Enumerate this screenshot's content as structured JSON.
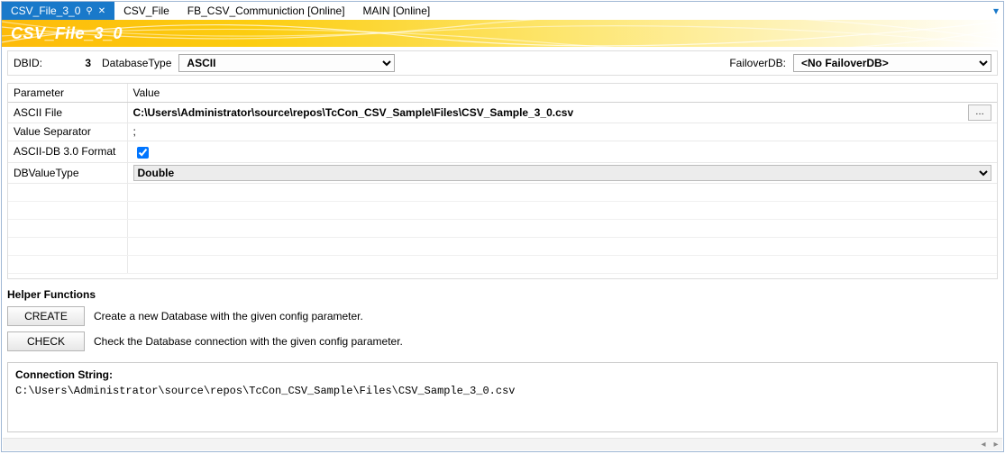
{
  "tabs": {
    "items": [
      {
        "label": "CSV_File_3_0",
        "active": true
      },
      {
        "label": "CSV_File",
        "active": false
      },
      {
        "label": "FB_CSV_Communiction [Online]",
        "active": false
      },
      {
        "label": "MAIN [Online]",
        "active": false
      }
    ]
  },
  "banner": {
    "title": "CSV_File_3_0"
  },
  "dbid": {
    "label": "DBID:",
    "value": "3",
    "dbtype_label": "DatabaseType",
    "dbtype_value": "ASCII",
    "failover_label": "FailoverDB:",
    "failover_value": "<No FailoverDB>"
  },
  "param_grid": {
    "headers": {
      "param": "Parameter",
      "value": "Value"
    },
    "rows": [
      {
        "param": "ASCII File",
        "value": "C:\\Users\\Administrator\\source\\repos\\TcCon_CSV_Sample\\Files\\CSV_Sample_3_0.csv",
        "type": "text-browse",
        "bold": true
      },
      {
        "param": "Value Separator",
        "value": ";",
        "type": "text",
        "bold": false
      },
      {
        "param": "ASCII-DB 3.0 Format",
        "value": true,
        "type": "checkbox"
      },
      {
        "param": "DBValueType",
        "value": "Double",
        "type": "select",
        "bold": true
      }
    ]
  },
  "helper": {
    "title": "Helper Functions",
    "create_label": "CREATE",
    "create_desc": "Create a new Database with the given config parameter.",
    "check_label": "CHECK",
    "check_desc": "Check the Database connection with the given config parameter."
  },
  "conn": {
    "title": "Connection String:",
    "value": "C:\\Users\\Administrator\\source\\repos\\TcCon_CSV_Sample\\Files\\CSV_Sample_3_0.csv"
  }
}
